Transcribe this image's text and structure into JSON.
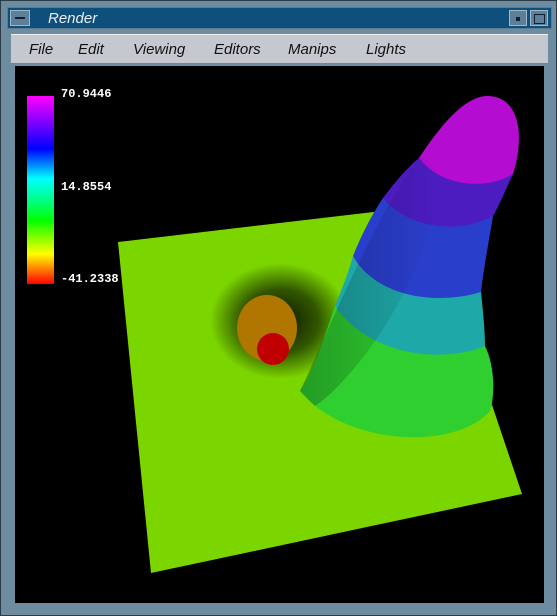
{
  "window": {
    "title": "Render"
  },
  "menubar": {
    "items": [
      {
        "id": "file",
        "label": "File"
      },
      {
        "id": "edit",
        "label": "Edit"
      },
      {
        "id": "viewing",
        "label": "Viewing"
      },
      {
        "id": "editors",
        "label": "Editors"
      },
      {
        "id": "manips",
        "label": "Manips"
      },
      {
        "id": "lights",
        "label": "Lights"
      }
    ]
  },
  "legend": {
    "max": "70.9446",
    "mid": "14.8554",
    "min": "-41.2338",
    "colors": [
      "#ff00ff",
      "#8000ff",
      "#0000ff",
      "#00ffff",
      "#00ff80",
      "#00ff00",
      "#aaff00",
      "#ffff00",
      "#ff8000",
      "#ff0000"
    ]
  },
  "scene": {
    "background": "#000000",
    "base_color": "#7bd600"
  }
}
